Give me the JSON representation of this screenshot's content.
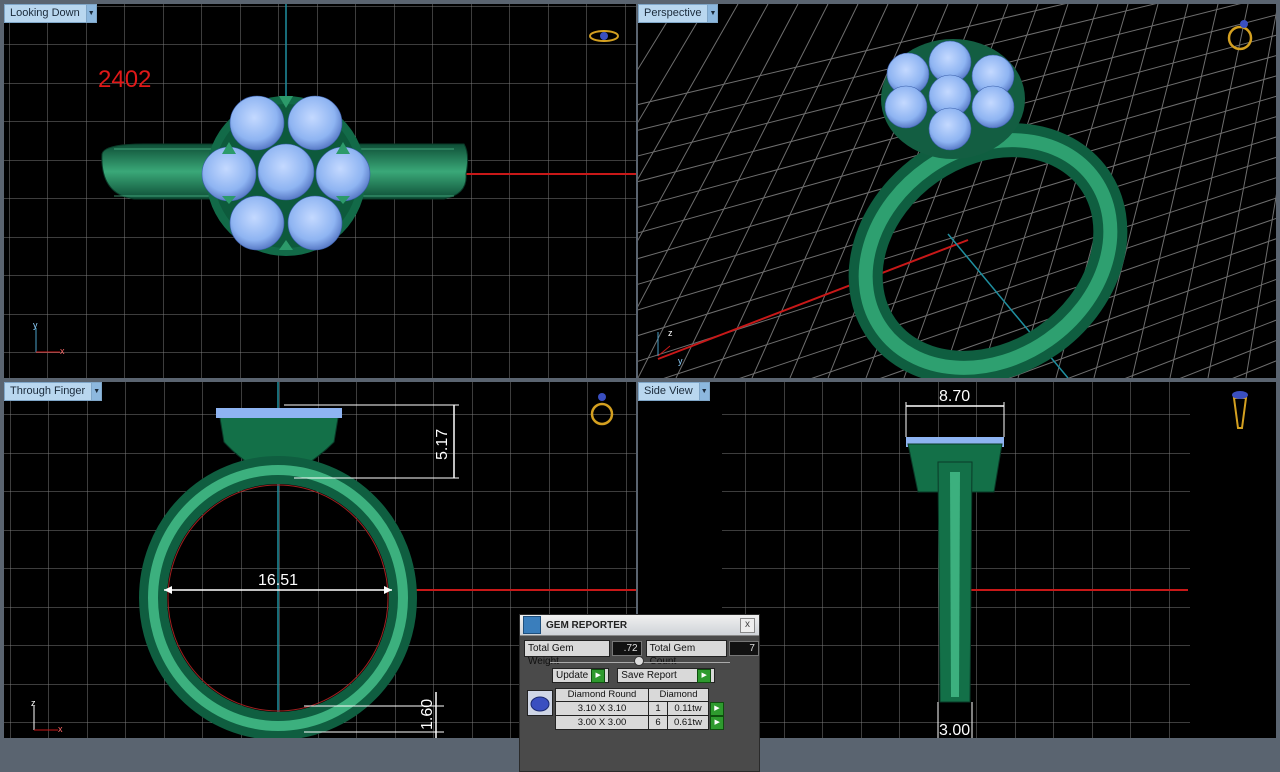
{
  "viewports": {
    "top_left": {
      "label": "Looking Down",
      "overlay_number": "2402",
      "axis": "y",
      "axis2": "x"
    },
    "top_right": {
      "label": "Perspective",
      "axis": "z",
      "axis2": "y"
    },
    "bottom_left": {
      "label": "Through Finger",
      "axis": "z",
      "axis2": "x",
      "dims": {
        "inner_diameter": "16.51",
        "head_height": "5.17",
        "shank_thickness": "1.60"
      }
    },
    "bottom_right": {
      "label": "Side View",
      "dims": {
        "head_width": "8.70",
        "shank_width": "3.00"
      }
    }
  },
  "gem_reporter": {
    "title": "GEM REPORTER",
    "close": "x",
    "total_weight_label": "Total Gem Weight",
    "total_weight_value": ".72",
    "total_count_label": "Total Gem Count",
    "total_count_value": "7",
    "update_label": "Update",
    "save_report_label": "Save Report",
    "table_headers": [
      "Diamond Round",
      "Diamond"
    ],
    "rows": [
      {
        "size": "3.10 X 3.10",
        "count": "1",
        "weight": "0.11tw"
      },
      {
        "size": "3.00 X 3.00",
        "count": "6",
        "weight": "0.61tw"
      }
    ]
  },
  "colors": {
    "metal": "#1a7a54",
    "metal_highlight": "#4fc08e",
    "gem": "#8eb4f2",
    "grid": "#7f7f7f",
    "red_axis": "#c81818",
    "cyan_axis": "#1f8fa0",
    "panel_bg": "#b9d7ef"
  }
}
